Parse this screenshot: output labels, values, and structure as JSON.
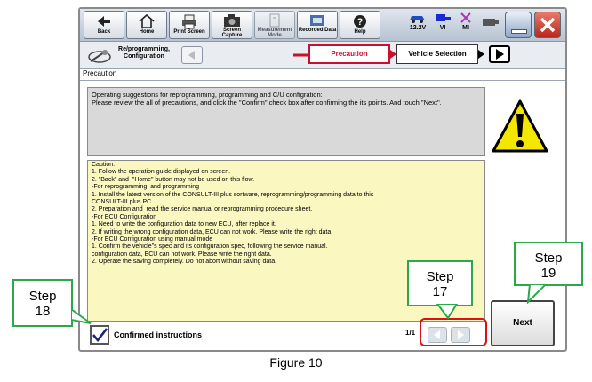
{
  "toolbar": {
    "buttons": [
      {
        "label": "Back",
        "icon": "back-arrow-icon"
      },
      {
        "label": "Home",
        "icon": "home-icon"
      },
      {
        "label": "Print Screen",
        "icon": "printer-icon"
      },
      {
        "label": "Screen Capture",
        "icon": "camera-icon"
      },
      {
        "label": "Measurement Mode",
        "icon": "meter-icon"
      },
      {
        "label": "Recorded Data",
        "icon": "recorded-data-icon"
      },
      {
        "label": "Help",
        "icon": "help-icon"
      }
    ],
    "status": {
      "voltage": "12.2V",
      "vi": "VI",
      "mi": "MI"
    }
  },
  "nav": {
    "module_label": "Re/programming, Configuration",
    "crumb_current": "Precaution",
    "crumb_next": "Vehicle Selection"
  },
  "section_title": "Precaution",
  "description": "Operating suggestions for reprogramming, programming and C/U configration:\nPlease review the all of precautions, and click the \"Confirm\" check box after confirming the its points. And touch \"Next\".",
  "caution_lines": [
    "Caution:",
    "1. Follow the operation guide displayed on screen.",
    "2. \"Back\" and  \"Home\" button may not be used on this flow.",
    "",
    "-For reprogramming  and programming",
    "1. Install the latest version of the CONSULT-III plus sortware, reprogramming/programming data to this",
    "CONSULT-III plus PC.",
    "2. Preparation and  read the service manual or reprogramming procedure sheet.",
    "",
    "-For ECU Configuration",
    "1. Need to write the configuration data to new ECU, after replace it.",
    "2. If writing the wrong configuration data, ECU can not work. Please write the right data.",
    "",
    "-For ECU Configuration using manual mode",
    "1. Confirm the vehicle\"s spec and its configuration spec, following the service manual.",
    "configuration data, ECU can not work. Please write the right data.",
    "2. Operate the saving completely. Do not abort without saving data."
  ],
  "confirm_label": "Confirmed instructions",
  "confirm_checked": true,
  "pager": "1/1",
  "next_label": "Next",
  "callouts": {
    "step18": "Step\n18",
    "step17": "Step\n17",
    "step19": "Step\n19"
  },
  "figure_caption": "Figure 10",
  "colors": {
    "accent_red": "#c8102e",
    "callout_green": "#2aa84a",
    "caution_bg": "#fbf7c1",
    "warning_yellow": "#f5e600"
  }
}
